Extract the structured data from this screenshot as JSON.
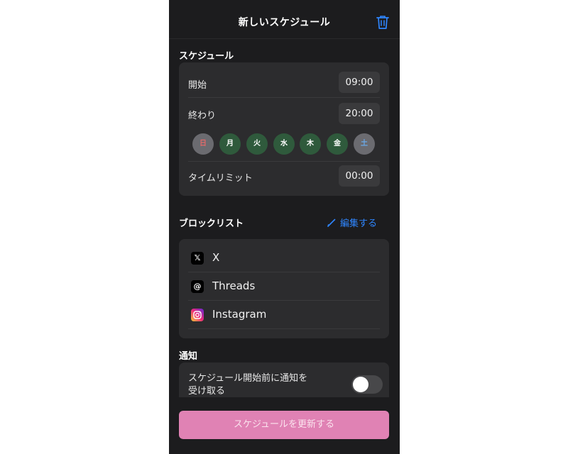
{
  "header": {
    "title": "新しいスケジュール",
    "delete_icon": "trash-icon",
    "accent": "#2f86ff"
  },
  "schedule": {
    "section_label": "スケジュール",
    "start": {
      "label": "開始",
      "value": "09:00"
    },
    "end": {
      "label": "終わり",
      "value": "20:00"
    },
    "days": [
      {
        "label": "日",
        "selected": false,
        "color": "#e06a6a"
      },
      {
        "label": "月",
        "selected": true
      },
      {
        "label": "火",
        "selected": true
      },
      {
        "label": "水",
        "selected": true
      },
      {
        "label": "木",
        "selected": true
      },
      {
        "label": "金",
        "selected": true
      },
      {
        "label": "土",
        "selected": false,
        "color": "#6aa8e6"
      }
    ],
    "time_limit": {
      "label": "タイムリミット",
      "value": "00:00"
    }
  },
  "blocklist": {
    "section_label": "ブロックリスト",
    "edit_label": "編集する",
    "edit_icon": "pencil-icon",
    "apps": [
      {
        "name": "X",
        "icon": "x-logo-icon"
      },
      {
        "name": "Threads",
        "icon": "threads-logo-icon"
      },
      {
        "name": "Instagram",
        "icon": "instagram-logo-icon"
      }
    ]
  },
  "notification": {
    "section_label": "通知",
    "option_line1": "スケジュール開始前に通知を",
    "option_line2": "受け取る",
    "enabled": false
  },
  "footer": {
    "update_label": "スケジュールを更新する",
    "button_color": "#e082b4"
  }
}
